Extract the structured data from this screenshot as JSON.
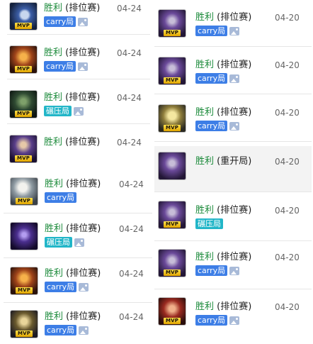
{
  "colors": {
    "win": "#1b8a3a",
    "carry_tag": "#3d7ee6",
    "crush_tag": "#22b6c8"
  },
  "left_records": [
    {
      "result": "胜利",
      "mode": "(排位赛)",
      "date": "04-24",
      "mvp": true,
      "tag": "carry局",
      "tag_type": "carry",
      "has_image": true,
      "avatar": "armored-blue-hero"
    },
    {
      "result": "胜利",
      "mode": "(排位赛)",
      "date": "04-24",
      "mvp": true,
      "tag": "carry局",
      "tag_type": "carry",
      "has_image": true,
      "avatar": "orange-warrior"
    },
    {
      "result": "胜利",
      "mode": "(排位赛)",
      "date": "04-24",
      "mvp": true,
      "tag": "碾压局",
      "tag_type": "crush",
      "has_image": true,
      "avatar": "dark-green-knight"
    },
    {
      "result": "胜利",
      "mode": "(排位赛)",
      "date": "04-24",
      "mvp": true,
      "tag": "",
      "tag_type": "",
      "has_image": false,
      "avatar": "purple-ninja"
    },
    {
      "result": "胜利",
      "mode": "(排位赛)",
      "date": "04-24",
      "mvp": true,
      "tag": "carry局",
      "tag_type": "carry",
      "has_image": false,
      "avatar": "white-hair-swordsman"
    },
    {
      "result": "胜利",
      "mode": "(排位赛)",
      "date": "04-24",
      "mvp": false,
      "tag": "碾压局",
      "tag_type": "crush",
      "has_image": true,
      "avatar": "hooded-assassin"
    },
    {
      "result": "胜利",
      "mode": "(排位赛)",
      "date": "04-24",
      "mvp": true,
      "tag": "carry局",
      "tag_type": "carry",
      "has_image": true,
      "avatar": "orange-warrior"
    },
    {
      "result": "胜利",
      "mode": "(排位赛)",
      "date": "04-24",
      "mvp": true,
      "tag": "carry局",
      "tag_type": "carry",
      "has_image": true,
      "avatar": "gold-knight"
    }
  ],
  "right_records": [
    {
      "result": "胜利",
      "mode": "(排位赛)",
      "date": "04-20",
      "mvp": true,
      "tag": "carry局",
      "tag_type": "carry",
      "has_image": true,
      "avatar": "purple-knight"
    },
    {
      "result": "胜利",
      "mode": "(排位赛)",
      "date": "04-20",
      "mvp": true,
      "tag": "carry局",
      "tag_type": "carry",
      "has_image": true,
      "avatar": "purple-knight"
    },
    {
      "result": "胜利",
      "mode": "(排位赛)",
      "date": "04-20",
      "mvp": true,
      "tag": "carry局",
      "tag_type": "carry",
      "has_image": true,
      "avatar": "yellow-golem"
    },
    {
      "result": "胜利",
      "mode": "(重开局)",
      "date": "04-20",
      "mvp": false,
      "tag": "",
      "tag_type": "",
      "has_image": false,
      "avatar": "purple-knight"
    },
    {
      "result": "胜利",
      "mode": "(排位赛)",
      "date": "04-20",
      "mvp": true,
      "tag": "碾压局",
      "tag_type": "crush",
      "has_image": false,
      "avatar": "purple-knight"
    },
    {
      "result": "胜利",
      "mode": "(排位赛)",
      "date": "04-20",
      "mvp": true,
      "tag": "carry局",
      "tag_type": "carry",
      "has_image": true,
      "avatar": "purple-knight"
    },
    {
      "result": "胜利",
      "mode": "(排位赛)",
      "date": "04-20",
      "mvp": true,
      "tag": "carry局",
      "tag_type": "carry",
      "has_image": true,
      "avatar": "red-warrior"
    }
  ]
}
